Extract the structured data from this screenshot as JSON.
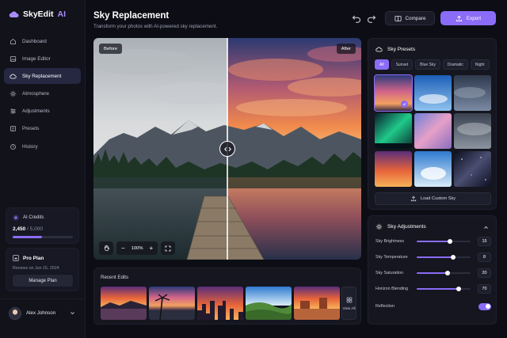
{
  "app": {
    "name": "SkyEdit",
    "name_suffix": "AI"
  },
  "colors": {
    "accent": "#8b6cf6",
    "background": "#0d0e15",
    "panel": "#15161f"
  },
  "sidebar": {
    "items": [
      {
        "label": "Dashboard",
        "icon": "dashboard-icon",
        "active": false
      },
      {
        "label": "Image Editor",
        "icon": "image-editor-icon",
        "active": false
      },
      {
        "label": "Sky Replacement",
        "icon": "cloud-icon",
        "active": true
      },
      {
        "label": "Atmosphere",
        "icon": "sun-icon",
        "active": false
      },
      {
        "label": "Adjustments",
        "icon": "sliders-icon",
        "active": false
      },
      {
        "label": "Presets",
        "icon": "presets-icon",
        "active": false
      },
      {
        "label": "History",
        "icon": "history-icon",
        "active": false
      }
    ],
    "credits": {
      "title": "AI Credits",
      "used": "2,450",
      "total": "/ 5,000",
      "fraction": 0.49
    },
    "plan": {
      "title": "Pro Plan",
      "renews": "Renews on Jun 15, 2024",
      "button": "Manage Plan"
    },
    "user": {
      "name": "Alex Johnson"
    }
  },
  "header": {
    "title": "Sky Replacement",
    "subtitle": "Transform your photos with AI-powered sky replacement.",
    "compare_label": "Compare",
    "export_label": "Export"
  },
  "canvas": {
    "before_label": "Before",
    "after_label": "After",
    "zoom": "100%"
  },
  "recent_edits": {
    "title": "Recent Edits",
    "view_all": "View All",
    "items": [
      "sunset-lake",
      "palm-beach",
      "city-skyline",
      "green-hills",
      "desert-mesa"
    ]
  },
  "presets": {
    "title": "Sky Presets",
    "chips": [
      {
        "label": "All",
        "active": true
      },
      {
        "label": "Sunset",
        "active": false
      },
      {
        "label": "Blue Sky",
        "active": false
      },
      {
        "label": "Dramatic",
        "active": false
      },
      {
        "label": "Night",
        "active": false
      }
    ],
    "selected_index": 0,
    "load_custom": "Load Custom Sky"
  },
  "adjustments": {
    "title": "Sky Adjustments",
    "sliders": [
      {
        "label": "Sky Brightness",
        "value": "15",
        "fraction": 0.62
      },
      {
        "label": "Sky Temperature",
        "value": "8",
        "fraction": 0.68
      },
      {
        "label": "Sky Saturation",
        "value": "20",
        "fraction": 0.58
      },
      {
        "label": "Horizon Blending",
        "value": "70",
        "fraction": 0.78
      }
    ],
    "reflection": {
      "label": "Reflection",
      "enabled": true
    }
  }
}
